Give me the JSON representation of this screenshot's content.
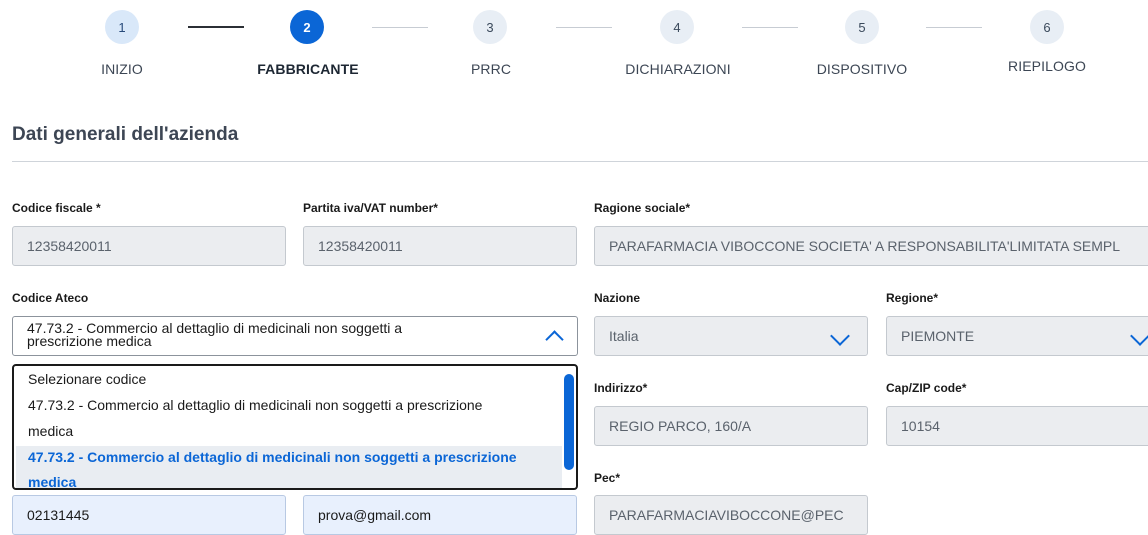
{
  "stepper": {
    "steps": [
      {
        "number": "1",
        "label": "INIZIO"
      },
      {
        "number": "2",
        "label": "FABBRICANTE"
      },
      {
        "number": "3",
        "label": "PRRC"
      },
      {
        "number": "4",
        "label": "DICHIARAZIONI"
      },
      {
        "number": "5",
        "label": "DISPOSITIVO"
      },
      {
        "number": "6",
        "label": "RIEPILOGO"
      }
    ],
    "current_step": 2
  },
  "section": {
    "title": "Dati generali dell'azienda"
  },
  "fields": {
    "codice_fiscale": {
      "label": "Codice fiscale *",
      "value": "12358420011"
    },
    "partita_iva": {
      "label": "Partita iva/VAT number*",
      "value": "12358420011"
    },
    "ragione_sociale": {
      "label": "Ragione sociale*",
      "value": "PARAFARMACIA VIBOCCONE SOCIETA' A RESPONSABILITA'LIMITATA SEMPL"
    },
    "codice_ateco": {
      "label": "Codice Ateco",
      "value_line1": "47.73.2 - Commercio al dettaglio di medicinali non soggetti a",
      "value_line2": "prescrizione medica",
      "options": [
        {
          "line1": "Selezionare codice",
          "line2": ""
        },
        {
          "line1": "47.73.2 - Commercio al dettaglio di medicinali non soggetti a prescrizione",
          "line2": "medica"
        },
        {
          "line1": "47.73.2 - Commercio al dettaglio di medicinali non soggetti a prescrizione",
          "line2": "medica",
          "selected": true
        }
      ]
    },
    "nazione": {
      "label": "Nazione",
      "value": "Italia"
    },
    "regione": {
      "label": "Regione*",
      "value": "PIEMONTE"
    },
    "indirizzo": {
      "label": "Indirizzo*",
      "value": "REGIO PARCO, 160/A"
    },
    "cap": {
      "label": "Cap/ZIP code*",
      "value": "10154"
    },
    "pec": {
      "label": "Pec*",
      "value": "PARAFARMACIAVIBOCCONE@PEC"
    },
    "telefono": {
      "value": "02131445"
    },
    "email": {
      "value": "prova@gmail.com"
    }
  },
  "colors": {
    "accent": "#0b66d6",
    "readonly_bg": "#ebedf0",
    "editable_bg": "#e8f0fd"
  }
}
